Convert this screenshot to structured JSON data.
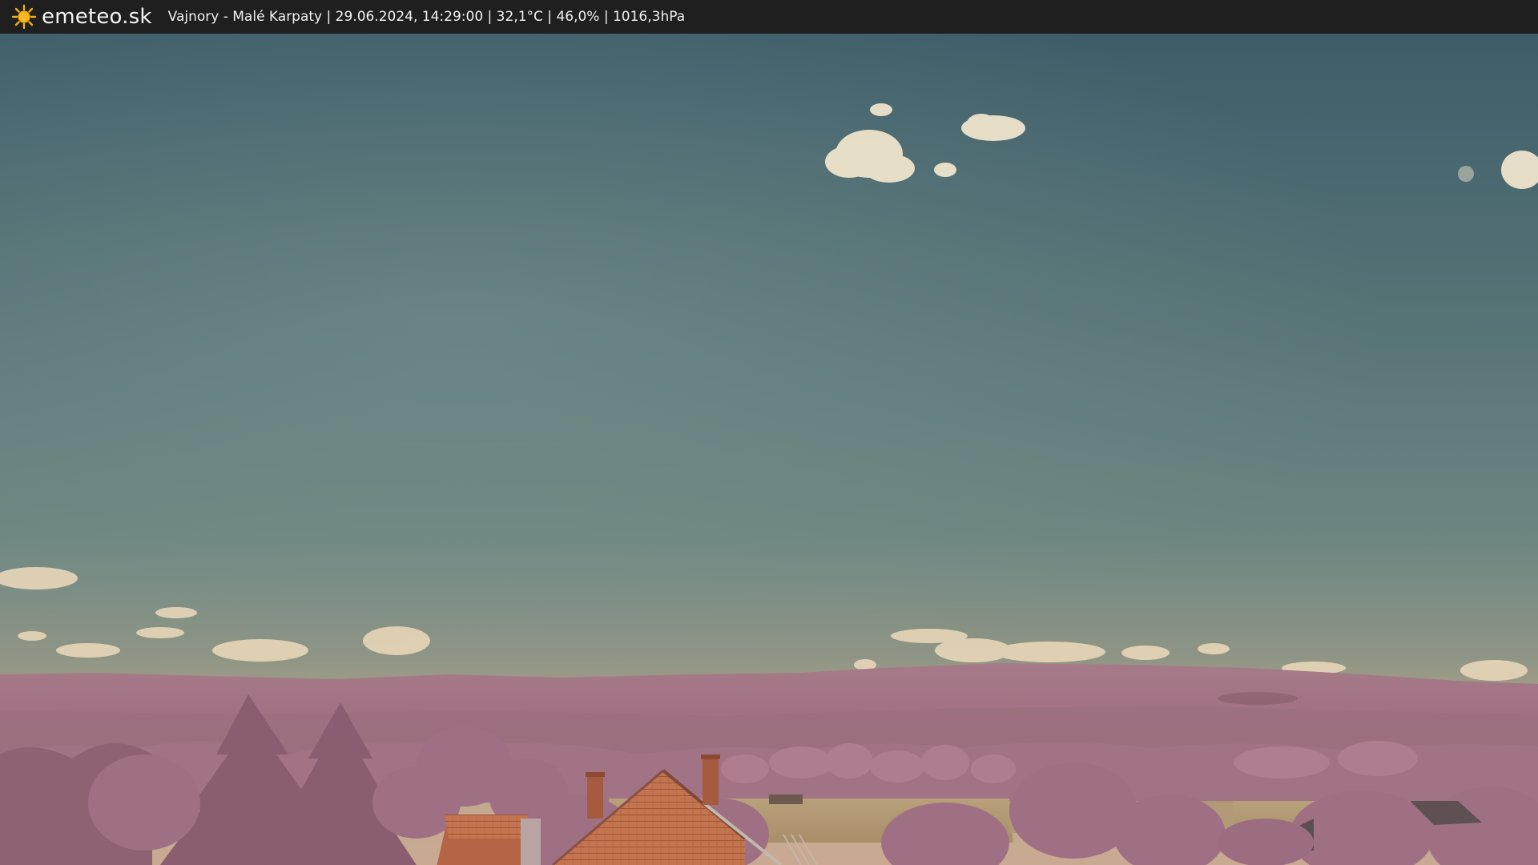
{
  "header": {
    "logo_icon": "sun-icon",
    "brand": "emeteo.sk",
    "caption": "Vajnory - Malé Karpaty | 29.06.2024, 14:29:00 | 32,1°C | 46,0% | 1016,3hPa"
  },
  "colors": {
    "topbar": "#1f1f1f",
    "sun": "#f2b01c",
    "sky_top": "#3f5f6a",
    "sky_mid": "#647e7f",
    "sky_horizon": "#b7a98f",
    "hills": "#a9788a",
    "foliage": "#9e6f80",
    "field": "#b49c74",
    "roof": "#c06a45"
  }
}
